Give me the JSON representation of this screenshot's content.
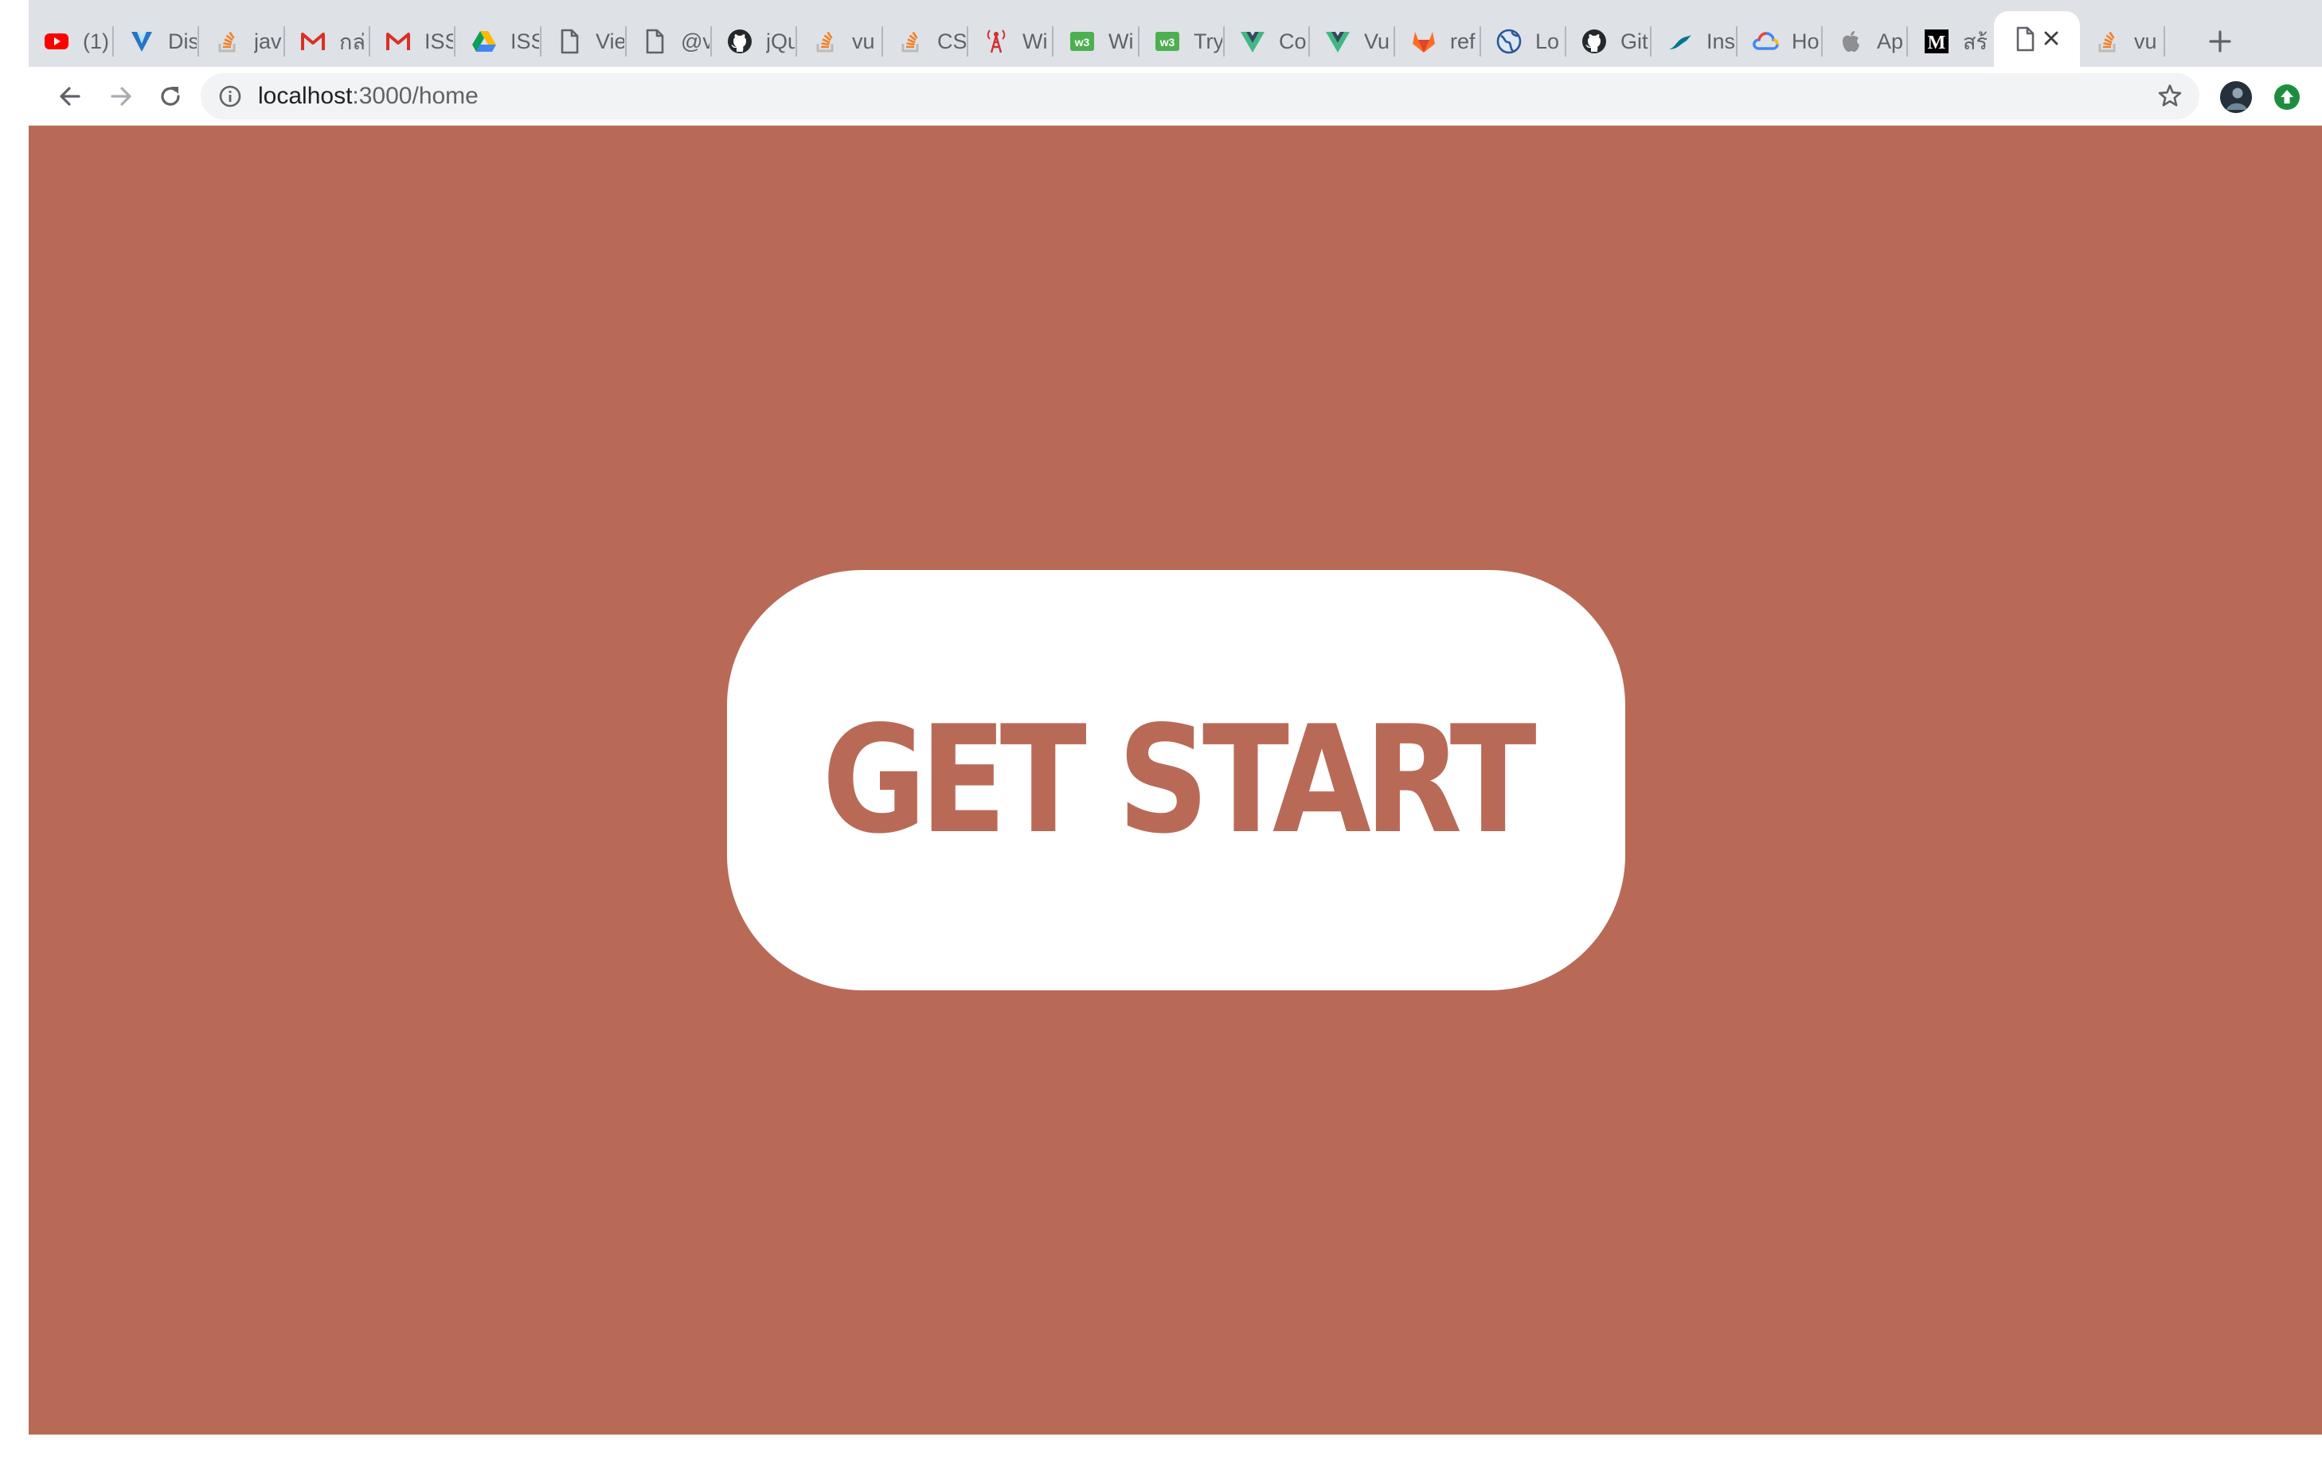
{
  "browser": {
    "tabs": [
      {
        "title": "(1)",
        "icon": "youtube-icon",
        "color": "#ff0000"
      },
      {
        "title": "Dis",
        "icon": "vuetify-icon",
        "color": "#1867c0"
      },
      {
        "title": "jav",
        "icon": "stackoverflow-icon",
        "color": "#f48024"
      },
      {
        "title": "กล่",
        "icon": "gmail-icon",
        "color": "#d93025"
      },
      {
        "title": "ISS",
        "icon": "gmail-icon",
        "color": "#d93025"
      },
      {
        "title": "ISS",
        "icon": "google-drive-icon",
        "color": "#0f9d58"
      },
      {
        "title": "Vie",
        "icon": "document-icon",
        "color": "#5f6368"
      },
      {
        "title": "@v",
        "icon": "document-icon",
        "color": "#5f6368"
      },
      {
        "title": "jQu",
        "icon": "github-icon",
        "color": "#24292e"
      },
      {
        "title": "vu",
        "icon": "stackoverflow-icon",
        "color": "#f48024"
      },
      {
        "title": "CS",
        "icon": "stackoverflow-icon",
        "color": "#f48024"
      },
      {
        "title": "Wi",
        "icon": "antenna-icon",
        "color": "#d32f2f"
      },
      {
        "title": "Wi",
        "icon": "w3schools-icon",
        "color": "#4caf50"
      },
      {
        "title": "Try",
        "icon": "w3schools-icon",
        "color": "#4caf50"
      },
      {
        "title": "Co",
        "icon": "vue-icon",
        "color": "#41b883"
      },
      {
        "title": "Vu",
        "icon": "vue-icon",
        "color": "#41b883"
      },
      {
        "title": "ref",
        "icon": "gitlab-icon",
        "color": "#fc6d26"
      },
      {
        "title": "Lo",
        "icon": "globe-icon",
        "color": "#2b5797"
      },
      {
        "title": "Git",
        "icon": "github-icon",
        "color": "#24292e"
      },
      {
        "title": "Ins",
        "icon": "mysql-icon",
        "color": "#00758f"
      },
      {
        "title": "Ho",
        "icon": "google-cloud-icon",
        "color": "#4285f4"
      },
      {
        "title": "Ap",
        "icon": "apple-icon",
        "color": "#8e8e93"
      },
      {
        "title": "สร้",
        "icon": "medium-icon",
        "color": "#000000"
      },
      {
        "title": "",
        "icon": "document-icon",
        "color": "#5f6368",
        "active": true
      },
      {
        "title": "vu",
        "icon": "stackoverflow-icon",
        "color": "#f48024"
      }
    ],
    "address": {
      "host": "localhost",
      "path": ":3000/home"
    }
  },
  "page": {
    "background": "#b96a57",
    "button_color": "#ffffff",
    "button_text_color": "#b96a57",
    "cta_label": "GET START"
  }
}
